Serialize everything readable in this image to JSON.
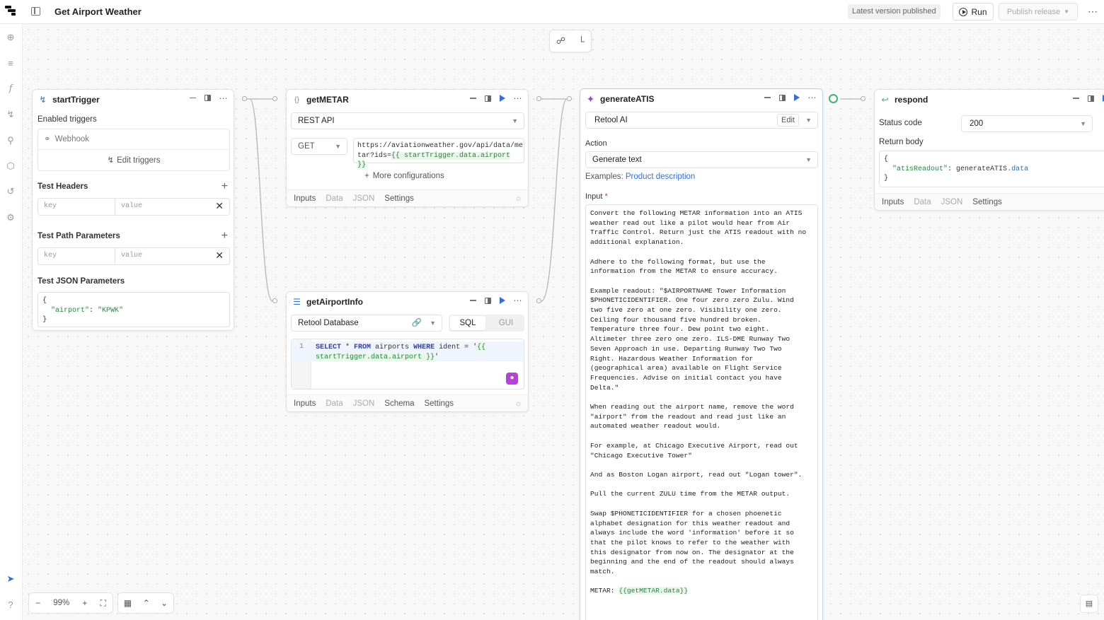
{
  "header": {
    "title": "Get Airport Weather",
    "version_status": "Latest version published",
    "run_label": "Run",
    "publish_label": "Publish release"
  },
  "zoom": {
    "level": "99%"
  },
  "start_trigger": {
    "title": "startTrigger",
    "enabled_triggers_label": "Enabled triggers",
    "webhook_label": "Webhook",
    "edit_triggers_label": "Edit triggers",
    "test_headers_label": "Test Headers",
    "test_path_params_label": "Test Path Parameters",
    "key_placeholder": "key",
    "value_placeholder": "value",
    "test_json_label": "Test JSON Parameters",
    "json_open": "{",
    "json_key": "\"airport\"",
    "json_colon": ": ",
    "json_value": "\"KPWK\"",
    "json_close": "}"
  },
  "get_metar": {
    "title": "getMETAR",
    "resource": "REST API",
    "method": "GET",
    "url_line1": "https://aviationweather.gov/api/data/me",
    "url_line2_prefix": "tar?ids=",
    "url_template": "{{ startTrigger.data.airport }}",
    "more_config": "More configurations",
    "tabs": [
      "Inputs",
      "Data",
      "JSON",
      "Settings"
    ]
  },
  "get_airport_info": {
    "title": "getAirportInfo",
    "resource": "Retool Database",
    "mode_sql": "SQL",
    "mode_gui": "GUI",
    "line_number": "1",
    "sql_kw1": "SELECT",
    "sql_star": " * ",
    "sql_kw2": "FROM",
    "sql_table": " airports ",
    "sql_kw3": "WHERE",
    "sql_cond": " ident = '",
    "sql_tmpl1": "{{",
    "sql_tmpl2": "startTrigger.data.airport }}",
    "sql_end": "'",
    "tabs": [
      "Inputs",
      "Data",
      "JSON",
      "Schema",
      "Settings"
    ]
  },
  "generate_atis": {
    "title": "generateATIS",
    "resource": "Retool AI",
    "edit_label": "Edit",
    "action_label": "Action",
    "action_value": "Generate text",
    "examples_label": "Examples:",
    "examples_link": "Product description",
    "input_label": "Input",
    "required_mark": "*",
    "prompt": "Convert the following METAR information into an ATIS\nweather read out like a pilot would hear from Air\nTraffic Control. Return just the ATIS readout with no\nadditional explanation.\n\nAdhere to the following format, but use the\ninformation from the METAR to ensure accuracy.\n\nExample readout: \"$AIRPORTNAME Tower Information\n$PHONETICIDENTIFIER. One four zero zero Zulu. Wind\ntwo five zero at one zero. Visibility one zero.\nCeiling four thousand five hundred broken.\nTemperature three four. Dew point two eight.\nAltimeter three zero one zero. ILS-DME Runway Two\nSeven Approach in use. Departing Runway Two Two\nRight. Hazardous Weather Information for\n(geographical area) available on Flight Service\nFrequencies. Advise on initial contact you have\nDelta.\"\n\nWhen reading out the airport name, remove the word\n\"airport\" from the readout and read just like an\nautomated weather readout would.\n\nFor example, at Chicago Executive Airport, read out\n\"Chicago Executive Tower\"\n\nAnd as Boston Logan airport, read out \"Logan tower\".\n\nPull the current ZULU time from the METAR output.\n\nSwap $PHONETICIDENTIFIER for a chosen phoenetic\nalphabet designation for this weather readout and\nalways include the word 'information' before it so\nthat the pilot knows to refer to the weather with\nthis designator from now on. The designator at the\nbeginning and the end of the readout should always\nmatch.\n\n",
    "metar_prefix": "METAR: ",
    "metar_template": "{{getMETAR.data}}"
  },
  "respond": {
    "title": "respond",
    "status_code_label": "Status code",
    "status_code_value": "200",
    "return_body_label": "Return body",
    "body_open": "{",
    "body_key": "\"atisReadout\"",
    "body_colon": ": ",
    "body_obj": "generateATIS",
    "body_prop": ".data",
    "body_close": "}",
    "tabs": [
      "Inputs",
      "Data",
      "JSON",
      "Settings"
    ]
  },
  "colors": {
    "accent_blue": "#2f6fe0",
    "ai_purple": "#8a4fd8",
    "connector_green": "#3cb371"
  }
}
